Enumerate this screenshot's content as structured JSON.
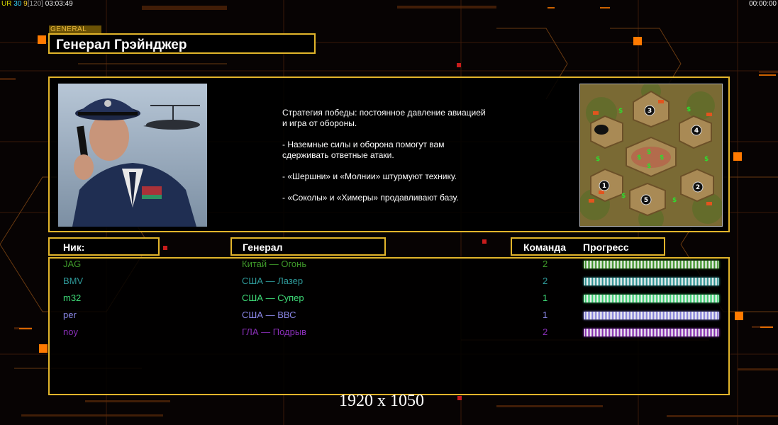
{
  "hud": {
    "left_parts": [
      "UR",
      " 30",
      " 9",
      "[120]",
      " 03:03:49"
    ],
    "right_time": "00:00:00"
  },
  "general": {
    "tag": "GENERAL",
    "name": "Генерал Грэйнджер"
  },
  "strategy": [
    "Стратегия победы: постоянное давление авиацией\n и игра от обороны.",
    "- Наземные силы и оборона помогут вам\n сдерживать ответные атаки.",
    "- «Шершни» и «Молнии» штурмуют технику.",
    "- «Соколы» и «Химеры» продавливают базу."
  ],
  "minimap": {
    "start_positions": [
      "1",
      "2",
      "3",
      "4",
      "5"
    ],
    "supply_marker": "$"
  },
  "headers": {
    "nick": "Ник:",
    "general": "Генерал",
    "team": "Команда",
    "progress": "Прогресс"
  },
  "players": [
    {
      "nick": "JAG",
      "general": "Китай — Огонь",
      "team": "2",
      "color": "#3f9a2a",
      "progress": 1.0
    },
    {
      "nick": "BMV",
      "general": "США — Лазер",
      "team": "2",
      "color": "#2f9a9a",
      "progress": 1.0
    },
    {
      "nick": "m32",
      "general": "США — Супер",
      "team": "1",
      "color": "#3fdc78",
      "progress": 1.0
    },
    {
      "nick": "per",
      "general": "США — ВВС",
      "team": "1",
      "color": "#8a86e6",
      "progress": 1.0
    },
    {
      "nick": "noy",
      "general": "ГЛА — Подрыв",
      "team": "2",
      "color": "#8a2fb8",
      "progress": 1.0
    }
  ],
  "resolution": "1920 x 1050",
  "colors": {
    "frame": "#e2b52b",
    "accent_orange": "#ff7a00",
    "accent_red": "#d01818"
  }
}
